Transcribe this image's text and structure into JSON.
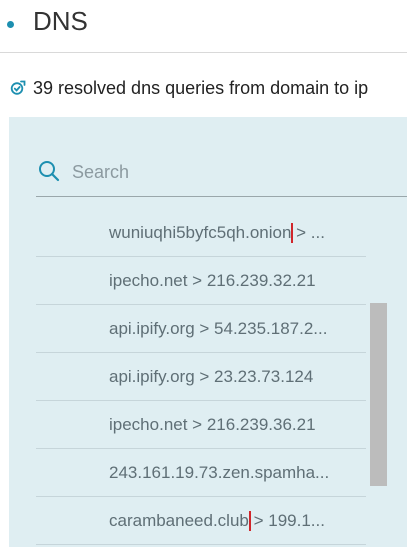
{
  "header": {
    "title": "DNS"
  },
  "summary": {
    "text": "39 resolved dns queries from domain to ip"
  },
  "search": {
    "placeholder": "Search"
  },
  "rows": [
    {
      "domain": "wuniuqhi5byfc5qh.onion",
      "rest": " > ...",
      "highlight": true
    },
    {
      "domain": "ipecho.net > 216.239.32.21",
      "rest": "",
      "highlight": false
    },
    {
      "domain": "api.ipify.org > 54.235.187.2...",
      "rest": "",
      "highlight": false
    },
    {
      "domain": "api.ipify.org > 23.23.73.124",
      "rest": "",
      "highlight": false
    },
    {
      "domain": "ipecho.net > 216.239.36.21",
      "rest": "",
      "highlight": false
    },
    {
      "domain": "243.161.19.73.zen.spamha...",
      "rest": "",
      "highlight": false
    },
    {
      "domain": "carambaneed.club",
      "rest": " > 199.1...",
      "highlight": true
    }
  ],
  "colors": {
    "accent": "#1d8fb0",
    "highlight_box": "#d0262b",
    "panel_bg": "#dfeef2"
  }
}
